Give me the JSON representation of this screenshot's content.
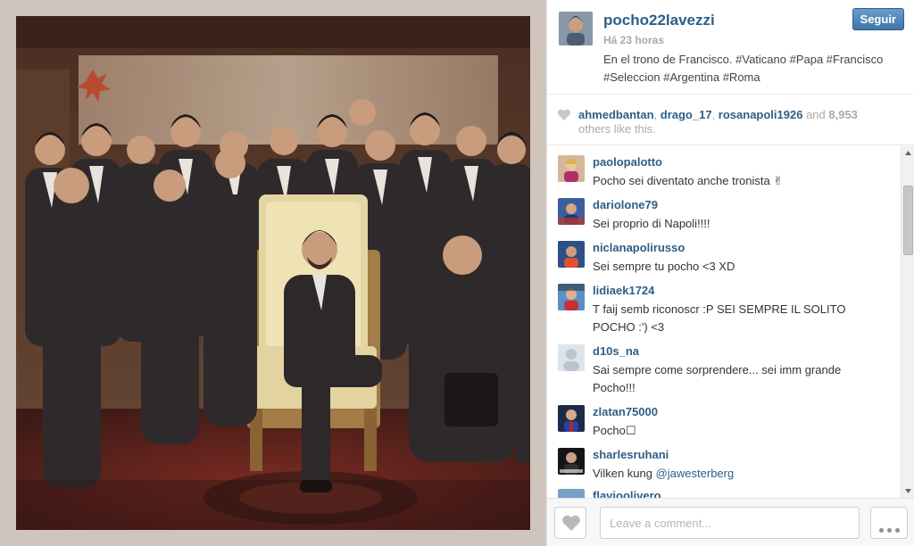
{
  "post": {
    "username": "pocho22lavezzi",
    "follow_label": "Seguir",
    "timestamp": "Há 23 horas",
    "caption_line1": "En el trono de Francisco. #Vaticano #Papa #Francisco",
    "caption_line2": "#Seleccion #Argentina #Roma"
  },
  "likes": {
    "names": [
      "ahmedbantan",
      "drago_17",
      "rosanapoli1926"
    ],
    "sep": ", ",
    "and_text": " and ",
    "count": "8,953",
    "suffix": "others like this."
  },
  "comments": [
    {
      "user": "paolopalotto",
      "lines": [
        "Pocho sei diventato anche tronista ✌"
      ]
    },
    {
      "user": "dariolone79",
      "lines": [
        "Sei proprio di Napoli!!!!"
      ]
    },
    {
      "user": "niclanapolirusso",
      "lines": [
        "Sei sempre tu pocho <3 XD"
      ]
    },
    {
      "user": "lidiaek1724",
      "lines": [
        "T faij semb riconoscr :P SEI SEMPRE IL SOLITO",
        "POCHO :') <3"
      ]
    },
    {
      "user": "d10s_na",
      "lines": [
        "Sai sempre come sorprendere... sei imm grande",
        "Pocho!!!"
      ]
    },
    {
      "user": "zlatan75000",
      "lines": [
        "Pocho☐"
      ]
    },
    {
      "user": "sharlesruhani",
      "text_prefix": "Vilken kung ",
      "mention": "@jawesterberg"
    },
    {
      "user": "flavioolivero",
      "lines": [
        ""
      ]
    }
  ],
  "footer": {
    "comment_placeholder": "Leave a comment..."
  },
  "icons": {
    "like": "heart-icon",
    "more": "more-dots-icon",
    "scroll_up": "chevron-up-icon",
    "scroll_down": "chevron-down-icon"
  },
  "colors": {
    "link": "#2e5e86",
    "follow_button": "#4a7fb3",
    "muted": "#a9a9a9"
  }
}
